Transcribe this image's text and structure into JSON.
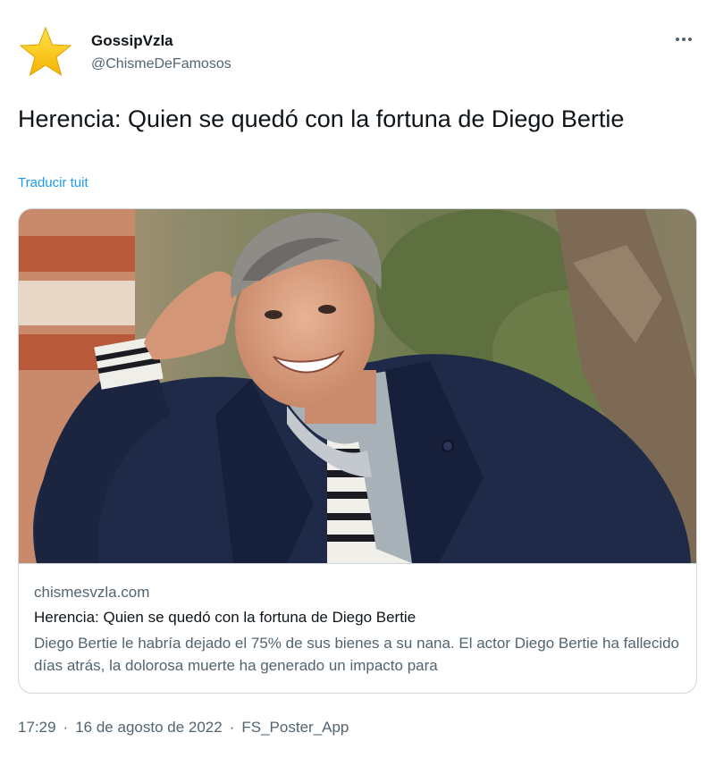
{
  "tweet": {
    "author_name": "GossipVzla",
    "author_handle": "@ChismeDeFamosos",
    "avatar_icon": "star-icon",
    "more_icon": "more-options-icon",
    "text": "Herencia: Quien se quedó con la fortuna de Diego Bertie",
    "translate_label": "Traducir tuit",
    "link_color": "#1d9bf0"
  },
  "card": {
    "image_description_icon": "photo-man-smiling-navy-coat-icon",
    "domain": "chismesvzla.com",
    "title": "Herencia: Quien se quedó con la fortuna de Diego Bertie",
    "description": "Diego Bertie le habría dejado el 75% de sus bienes a su nana. El actor Diego Bertie ha fallecido días atrás, la dolorosa muerte ha generado un impacto para"
  },
  "meta": {
    "time": "17:29",
    "date": "16 de agosto de 2022",
    "source": "FS_Poster_App",
    "separator": "·"
  }
}
